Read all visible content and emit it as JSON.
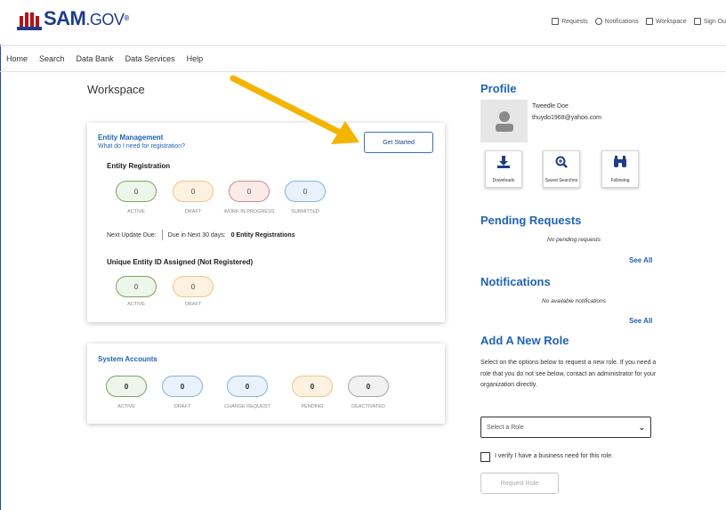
{
  "brand": {
    "name": "SAM",
    "suffix": ".GOV",
    "mark": "®"
  },
  "top_links": [
    {
      "label": "Requests",
      "icon": "requests-icon"
    },
    {
      "label": "Notifications",
      "icon": "notifications-icon"
    },
    {
      "label": "Workspace",
      "icon": "workspace-icon"
    },
    {
      "label": "Sign Ou",
      "icon": "sign-out-icon"
    }
  ],
  "nav": [
    "Home",
    "Search",
    "Data Bank",
    "Data Services",
    "Help"
  ],
  "workspace": {
    "title": "Workspace",
    "entity_management": {
      "title": "Entity Management",
      "help_link": "What do I need for registration?",
      "get_started": "Get Started",
      "registration": {
        "title": "Entity Registration",
        "statuses": [
          {
            "value": "0",
            "label": "ACTIVE"
          },
          {
            "value": "0",
            "label": "DRAFT"
          },
          {
            "value": "0",
            "label": "WORK IN PROGRESS"
          },
          {
            "value": "0",
            "label": "SUBMITTED"
          }
        ],
        "next_update_label": "Next Update Due:",
        "due_text": "Due in Next 30 days:",
        "due_count_text": "0 Entity Registrations"
      },
      "uei": {
        "title": "Unique Entity ID Assigned (Not Registered)",
        "statuses": [
          {
            "value": "0",
            "label": "ACTIVE"
          },
          {
            "value": "0",
            "label": "DRAFT"
          }
        ]
      }
    },
    "system_accounts": {
      "title": "System Accounts",
      "statuses": [
        {
          "value": "0",
          "label": "ACTIVE"
        },
        {
          "value": "0",
          "label": "DRAFT"
        },
        {
          "value": "0",
          "label": "CHANGE REQUEST"
        },
        {
          "value": "0",
          "label": "PENDING"
        },
        {
          "value": "0",
          "label": "DEACTIVATED"
        }
      ]
    }
  },
  "profile": {
    "title": "Profile",
    "name": "Tweedle Doe",
    "email": "thuydo1968@yahoo.com",
    "tiles": [
      {
        "label": "Downloads",
        "icon": "download-icon"
      },
      {
        "label": "Saved Searches",
        "icon": "saved-search-icon"
      },
      {
        "label": "Following",
        "icon": "binoculars-icon"
      }
    ]
  },
  "pending_requests": {
    "title": "Pending Requests",
    "message": "No pending requests",
    "see_all": "See All"
  },
  "notifications": {
    "title": "Notifications",
    "message": "No available notifications",
    "see_all": "See All"
  },
  "add_role": {
    "title": "Add A New Role",
    "description": "Select on the options below to request a new role. If you need a role that you do not see below, contact an administrator for your organization directly.",
    "select_placeholder": "Select a Role",
    "verify_label": "I verify I have a business need for this role.",
    "request_button": "Request Role"
  },
  "colors": {
    "primary_blue": "#1f63b3",
    "brand_red": "#b5121b",
    "arrow": "#f5b400"
  }
}
